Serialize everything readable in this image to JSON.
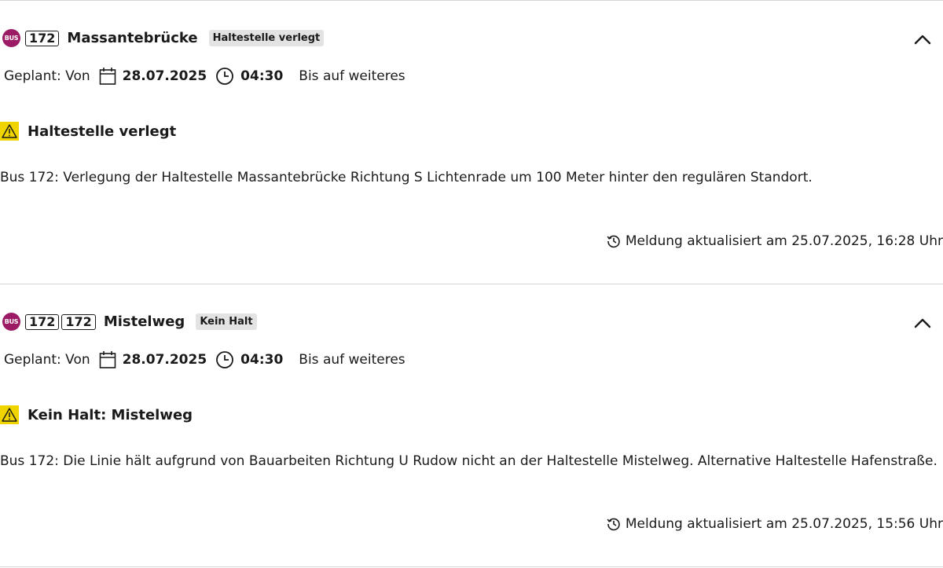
{
  "disruptions": [
    {
      "mode_label": "BUS",
      "lines": [
        "172"
      ],
      "stop": "Massantebrücke",
      "tag": "Haltestelle verlegt",
      "planned_label": "Geplant: Von",
      "date": "28.07.2025",
      "time": "04:30",
      "until": "Bis auf weiteres",
      "title": "Haltestelle verlegt",
      "description": "Bus 172: Verlegung der Haltestelle Massantebrücke Richtung S Lichtenrade um 100 Meter hinter den regulären Standort.",
      "updated": "Meldung aktualisiert am 25.07.2025, 16:28 Uhr"
    },
    {
      "mode_label": "BUS",
      "lines": [
        "172",
        "172"
      ],
      "stop": "Mistelweg",
      "tag": "Kein Halt",
      "planned_label": "Geplant: Von",
      "date": "28.07.2025",
      "time": "04:30",
      "until": "Bis auf weiteres",
      "title": "Kein Halt: Mistelweg",
      "description": "Bus 172: Die Linie hält aufgrund von Bauarbeiten Richtung U Rudow nicht an der Haltestelle Mistelweg. Alternative Haltestelle Hafenstraße.",
      "updated": "Meldung aktualisiert am 25.07.2025, 15:56 Uhr"
    }
  ],
  "icons": {
    "bus": "bus-icon",
    "calendar": "calendar-icon",
    "clock": "clock-icon",
    "warning": "warning-icon",
    "history": "history-icon",
    "collapse": "chevron-up-icon"
  },
  "colors": {
    "bus_brand": "#9b1b64",
    "warning_yellow": "#f0d400",
    "tag_bg": "#e3e3e3",
    "divider": "#d6d6d6"
  }
}
